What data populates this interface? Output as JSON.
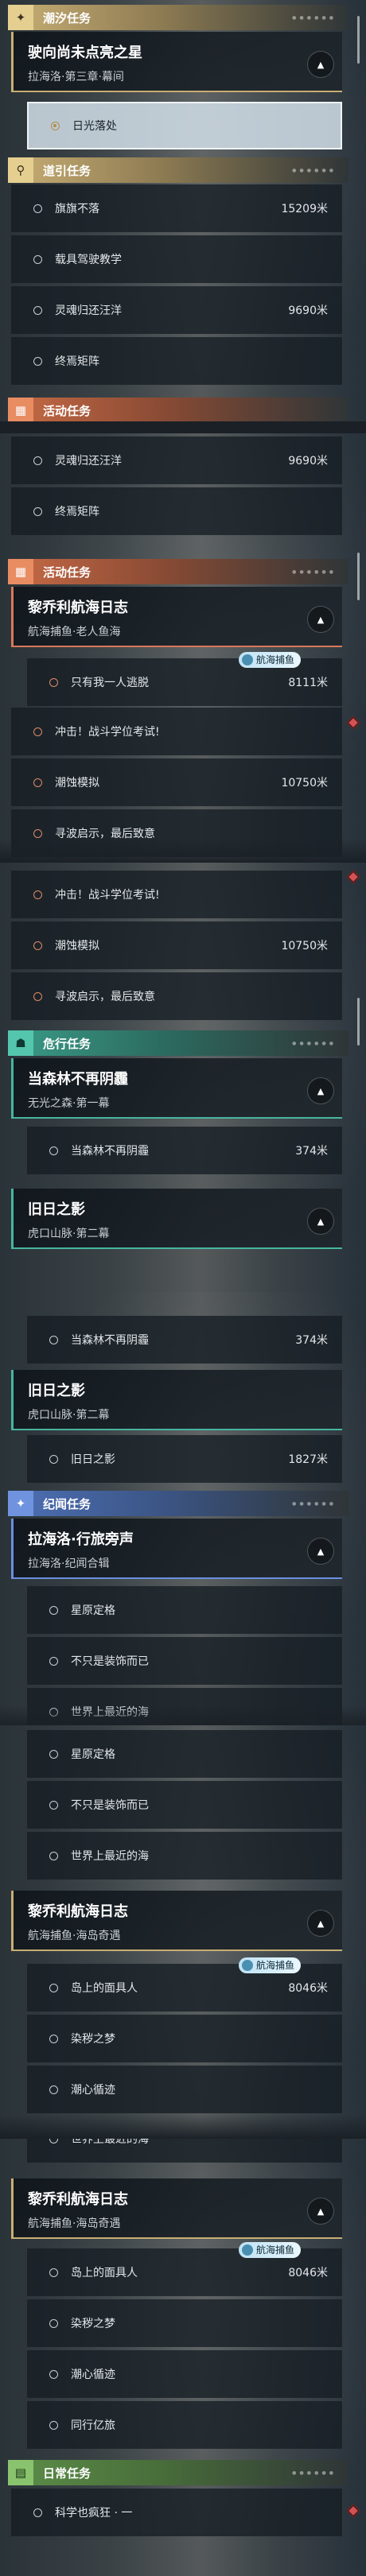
{
  "categories": {
    "tide": "潮汐任务",
    "guide": "道引任务",
    "activity": "活动任务",
    "danger": "危行任务",
    "record": "纪闻任务",
    "daily": "日常任务"
  },
  "missions": {
    "m1": {
      "title": "驶向尚未点亮之星",
      "subtitle": "拉海洛·第三章·幕间"
    },
    "m2": {
      "title": "黎乔利航海日志",
      "subtitle": "航海捕鱼·老人鱼海"
    },
    "m3": {
      "title": "当森林不再阴霾",
      "subtitle": "无光之森·第一幕"
    },
    "m4": {
      "title": "旧日之影",
      "subtitle": "虎口山脉·第二幕"
    },
    "m5": {
      "title": "拉海洛·行旅旁声",
      "subtitle": "拉海洛·纪闻合辑"
    },
    "m6": {
      "title": "黎乔利航海日志",
      "subtitle": "航海捕鱼·海岛奇遇"
    }
  },
  "tasks": {
    "rising_light": "日光落处",
    "flag": "旗旗不落",
    "vehicle": "载具驾驶教学",
    "soul_return": "灵魂归还汪洋",
    "final_array": "终焉矩阵",
    "one_escape": "只有我一人逃脱",
    "combat_exam": "冲击！战斗学位考试!",
    "tide_sim": "潮蚀模拟",
    "seek_inspire": "寻波启示，最后致意",
    "forest": "当森林不再阴霾",
    "old_shadow": "旧日之影",
    "star_map": "星原定格",
    "not_decor": "不只是装饰而已",
    "last_sea": "世界上最近的海",
    "island_fish": "岛上的面具人",
    "dye_dream": "染秽之梦",
    "heart_flow": "潮心循迹",
    "together": "同行亿旅",
    "science": "科学也疯狂 · 一"
  },
  "distances": {
    "flag": "15209米",
    "soul": "9690米",
    "one_escape": "8111米",
    "tide_sim": "10750米",
    "forest": "374米",
    "old_shadow": "1827米",
    "island": "8046米"
  },
  "tag": {
    "fishing": "航海捕鱼"
  },
  "icons": {
    "tide": "sparkle-icon",
    "guide": "location-pin-icon",
    "activity": "calendar-icon",
    "danger": "mask-icon",
    "record": "sparkle-icon",
    "daily": "book-icon"
  }
}
